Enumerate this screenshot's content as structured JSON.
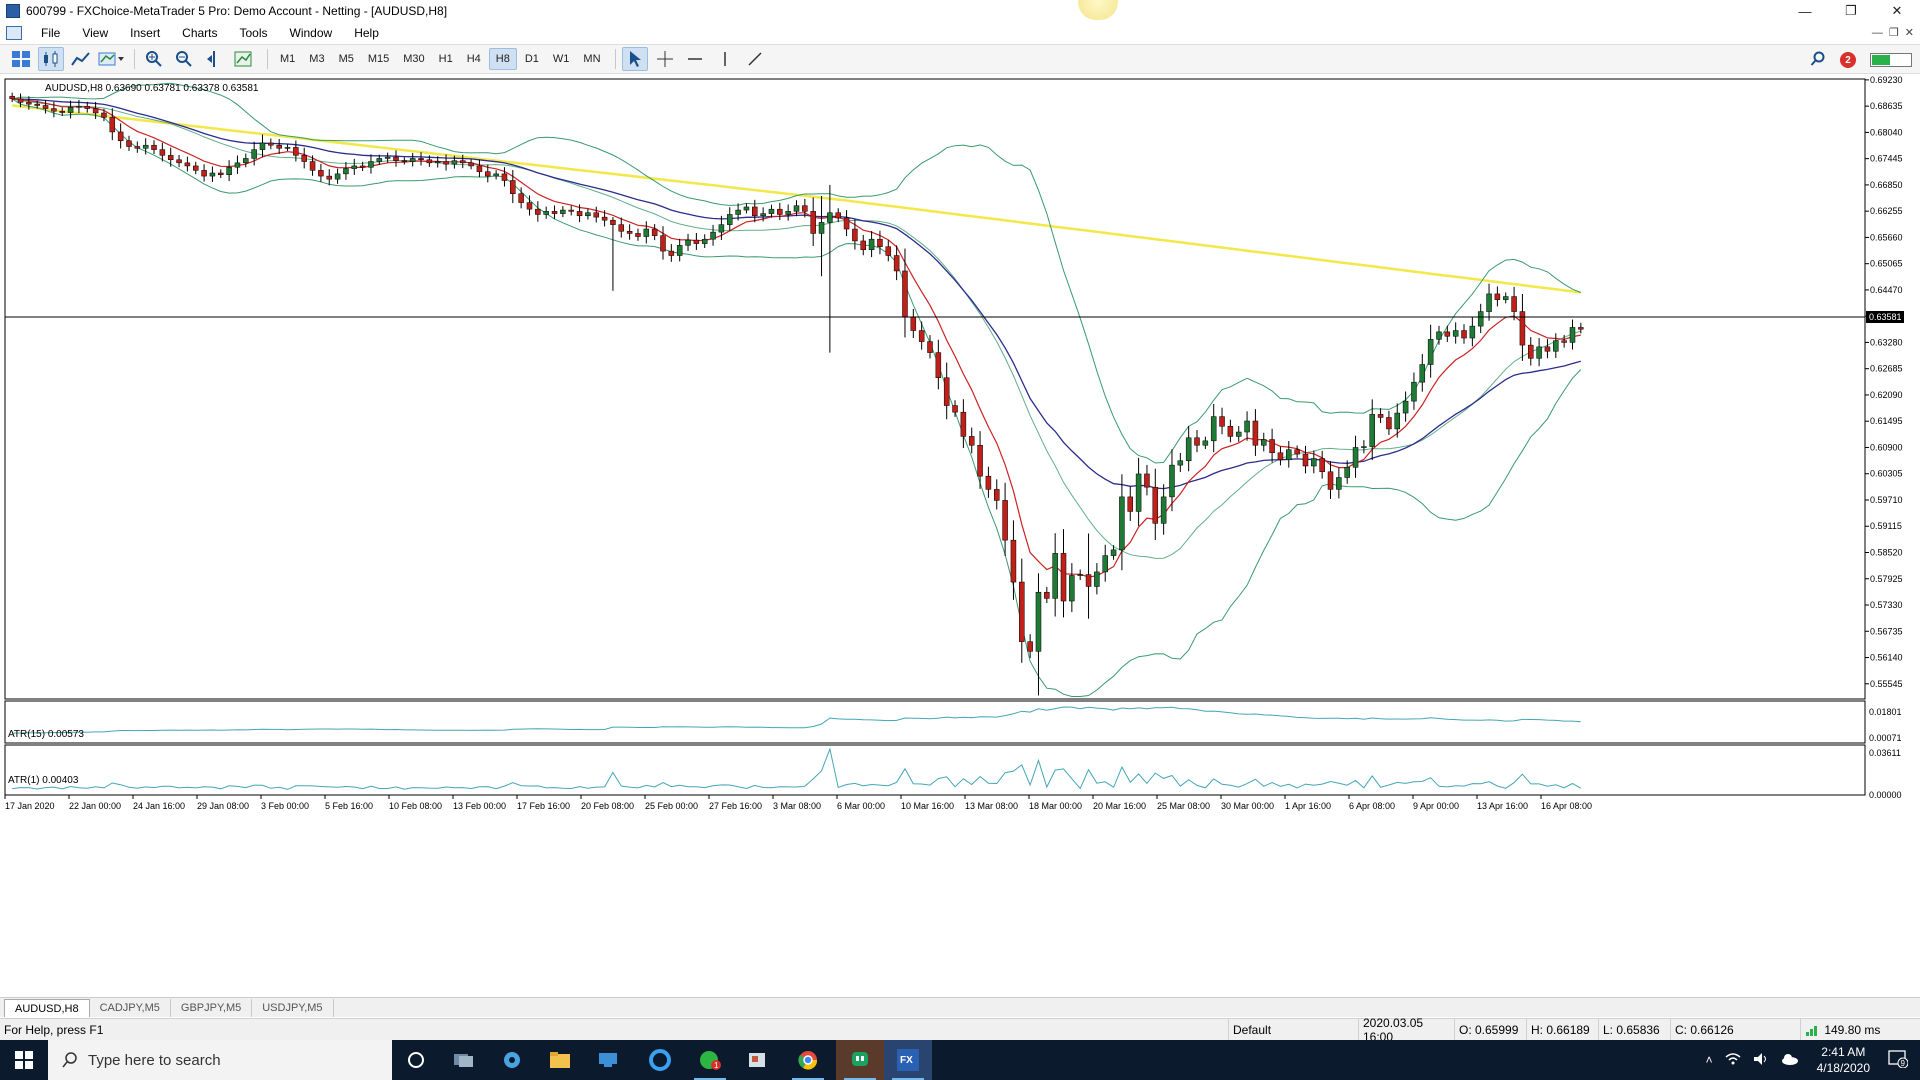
{
  "window": {
    "title": "600799 - FXChoice-MetaTrader 5 Pro: Demo Account - Netting - [AUDUSD,H8]"
  },
  "menu": [
    "File",
    "View",
    "Insert",
    "Charts",
    "Tools",
    "Window",
    "Help"
  ],
  "timeframes": [
    "M1",
    "M3",
    "M5",
    "M15",
    "M30",
    "H1",
    "H4",
    "H8",
    "D1",
    "W1",
    "MN"
  ],
  "active_timeframe": "H8",
  "notifications_count": "2",
  "chart": {
    "header": "AUDUSD,H8  0.63690 0.63781 0.63378 0.63581",
    "current_price_label": "0.63581",
    "price_ticks": [
      "0.69230",
      "0.68635",
      "0.68040",
      "0.67445",
      "0.66850",
      "0.66255",
      "0.65660",
      "0.65065",
      "0.64470",
      "0.63875",
      "0.63280",
      "0.62685",
      "0.62090",
      "0.61495",
      "0.60900",
      "0.60305",
      "0.59710",
      "0.59115",
      "0.58520",
      "0.57925",
      "0.57330",
      "0.56735",
      "0.56140",
      "0.55545"
    ],
    "time_ticks": [
      "17 Jan 2020",
      "22 Jan 00:00",
      "24 Jan 16:00",
      "29 Jan 08:00",
      "3 Feb 00:00",
      "5 Feb 16:00",
      "10 Feb 08:00",
      "13 Feb 00:00",
      "17 Feb 16:00",
      "20 Feb 08:00",
      "25 Feb 00:00",
      "27 Feb 16:00",
      "3 Mar 08:00",
      "6 Mar 00:00",
      "10 Mar 16:00",
      "13 Mar 08:00",
      "18 Mar 00:00",
      "20 Mar 16:00",
      "25 Mar 08:00",
      "30 Mar 00:00",
      "1 Apr 16:00",
      "6 Apr 08:00",
      "9 Apr 00:00",
      "13 Apr 16:00",
      "16 Apr 08:00"
    ],
    "atr15": {
      "label": "ATR(15) 0.00573",
      "ticks": [
        "0.01801",
        "0.00071"
      ]
    },
    "atr1": {
      "label": "ATR(1) 0.00403",
      "ticks": [
        "0.03611",
        "0.00000"
      ]
    },
    "colors": {
      "bull": "#1f7a36",
      "bear": "#c0201a",
      "ma_fast": "#cc2222",
      "ma_slow": "#2c2c8c",
      "ma_long": "#f2e84a",
      "bands": "#3a9a6e",
      "atr": "#43a6b5"
    }
  },
  "chart_data": {
    "type": "candlestick",
    "symbol": "AUDUSD",
    "timeframe": "H8",
    "ylim": [
      0.552,
      0.6925
    ],
    "closes": [
      0.688,
      0.6872,
      0.6868,
      0.6865,
      0.6858,
      0.6852,
      0.6849,
      0.6861,
      0.6863,
      0.6858,
      0.6848,
      0.6838,
      0.6805,
      0.6785,
      0.6772,
      0.6768,
      0.6775,
      0.6765,
      0.6752,
      0.6742,
      0.6735,
      0.6728,
      0.6718,
      0.6705,
      0.6712,
      0.6708,
      0.6725,
      0.6735,
      0.6745,
      0.6765,
      0.678,
      0.6775,
      0.6768,
      0.677,
      0.6752,
      0.6738,
      0.6718,
      0.6705,
      0.6698,
      0.671,
      0.6722,
      0.6728,
      0.6725,
      0.6738,
      0.6745,
      0.6748,
      0.674,
      0.6738,
      0.6745,
      0.6742,
      0.6735,
      0.6738,
      0.6732,
      0.674,
      0.6735,
      0.6728,
      0.6715,
      0.6705,
      0.671,
      0.6695,
      0.6665,
      0.6645,
      0.663,
      0.6618,
      0.6625,
      0.662,
      0.6628,
      0.6625,
      0.6615,
      0.6622,
      0.6612,
      0.6605,
      0.6595,
      0.658,
      0.6575,
      0.6568,
      0.6585,
      0.657,
      0.6535,
      0.6525,
      0.6548,
      0.656,
      0.6552,
      0.6562,
      0.6578,
      0.6595,
      0.6618,
      0.6628,
      0.6635,
      0.6615,
      0.662,
      0.663,
      0.6618,
      0.6625,
      0.6638,
      0.6625,
      0.6575,
      0.66,
      0.6622,
      0.661,
      0.6585,
      0.6558,
      0.6538,
      0.6562,
      0.6545,
      0.6525,
      0.649,
      0.6385,
      0.6355,
      0.633,
      0.6305,
      0.6248,
      0.6185,
      0.617,
      0.6115,
      0.6095,
      0.6025,
      0.5995,
      0.597,
      0.588,
      0.5785,
      0.565,
      0.5628,
      0.5762,
      0.5748,
      0.585,
      0.5742,
      0.58,
      0.5802,
      0.5775,
      0.5808,
      0.5845,
      0.5858,
      0.5978,
      0.5945,
      0.603,
      0.6,
      0.5918,
      0.5978,
      0.605,
      0.606,
      0.6112,
      0.6095,
      0.6105,
      0.616,
      0.6138,
      0.6115,
      0.6125,
      0.615,
      0.6095,
      0.6108,
      0.6078,
      0.6062,
      0.6085,
      0.6075,
      0.6048,
      0.6065,
      0.6035,
      0.5995,
      0.6022,
      0.6045,
      0.609,
      0.6092,
      0.6165,
      0.6158,
      0.6132,
      0.6168,
      0.6195,
      0.6238,
      0.6278,
      0.6335,
      0.6352,
      0.6342,
      0.6355,
      0.6338,
      0.6365,
      0.6398,
      0.6438,
      0.6425,
      0.6432,
      0.6398,
      0.6322,
      0.6292,
      0.6318,
      0.6308,
      0.6332,
      0.6328,
      0.6362,
      0.6358
    ]
  }
}
